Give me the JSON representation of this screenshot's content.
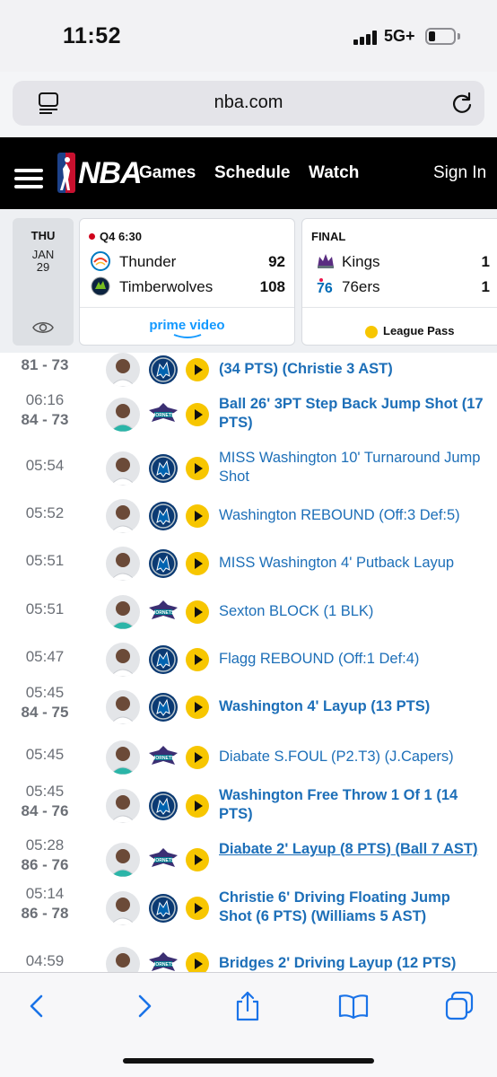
{
  "status_bar": {
    "time": "11:52",
    "network": "5G+"
  },
  "browser": {
    "url": "nba.com"
  },
  "nav": {
    "links": [
      "Games",
      "Schedule",
      "Watch"
    ],
    "sign_in": "Sign In"
  },
  "scoreboard": {
    "date": {
      "dow": "THU",
      "month": "JAN",
      "day": "29"
    },
    "games": [
      {
        "status": "Q4 6:30",
        "live": true,
        "teams": [
          {
            "name": "Thunder",
            "score": "92"
          },
          {
            "name": "Timberwolves",
            "score": "108"
          }
        ],
        "broadcast": "prime video"
      },
      {
        "status": "FINAL",
        "live": false,
        "teams": [
          {
            "name": "Kings",
            "score": "1"
          },
          {
            "name": "76ers",
            "score": "1"
          }
        ],
        "broadcast": "League Pass"
      }
    ]
  },
  "plays": [
    {
      "time": "",
      "score": "81 - 73",
      "team": "mavericks",
      "desc": "(34 PTS) (Christie 3 AST)",
      "bold": true,
      "underline": false
    },
    {
      "time": "06:16",
      "score": "84 - 73",
      "team": "hornets",
      "desc": "Ball 26' 3PT Step Back Jump Shot (17 PTS)",
      "bold": true,
      "underline": false
    },
    {
      "time": "05:54",
      "score": "",
      "team": "mavericks",
      "desc": "MISS Washington 10' Turnaround Jump Shot",
      "bold": false,
      "underline": false
    },
    {
      "time": "05:52",
      "score": "",
      "team": "mavericks",
      "desc": "Washington REBOUND (Off:3 Def:5)",
      "bold": false,
      "underline": false
    },
    {
      "time": "05:51",
      "score": "",
      "team": "mavericks",
      "desc": "MISS Washington 4' Putback Layup",
      "bold": false,
      "underline": false
    },
    {
      "time": "05:51",
      "score": "",
      "team": "hornets",
      "desc": "Sexton BLOCK (1 BLK)",
      "bold": false,
      "underline": false
    },
    {
      "time": "05:47",
      "score": "",
      "team": "mavericks",
      "desc": "Flagg REBOUND (Off:1 Def:4)",
      "bold": false,
      "underline": false
    },
    {
      "time": "05:45",
      "score": "84 - 75",
      "team": "mavericks",
      "desc": "Washington 4' Layup (13 PTS)",
      "bold": true,
      "underline": false
    },
    {
      "time": "05:45",
      "score": "",
      "team": "hornets",
      "desc": "Diabate S.FOUL (P2.T3) (J.Capers)",
      "bold": false,
      "underline": false
    },
    {
      "time": "05:45",
      "score": "84 - 76",
      "team": "mavericks",
      "desc": "Washington Free Throw 1 Of 1 (14 PTS)",
      "bold": true,
      "underline": false
    },
    {
      "time": "05:28",
      "score": "86 - 76",
      "team": "hornets",
      "desc": "Diabate 2' Layup (8 PTS) (Ball 7 AST)",
      "bold": true,
      "underline": true
    },
    {
      "time": "05:14",
      "score": "86 - 78",
      "team": "mavericks",
      "desc": "Christie 6' Driving Floating Jump Shot (6 PTS) (Williams 5 AST)",
      "bold": true,
      "underline": false
    },
    {
      "time": "04:59",
      "score": "",
      "team": "hornets",
      "desc": "Bridges 2' Driving Layup (12 PTS)",
      "bold": true,
      "underline": false
    }
  ],
  "colors": {
    "nba_nav": "#000000",
    "link": "#1d6fb8",
    "play_button": "#f7c600",
    "live_dot": "#d0021b",
    "mavs_blue": "#0b3a73",
    "hornets_purple": "#3b2f73"
  }
}
